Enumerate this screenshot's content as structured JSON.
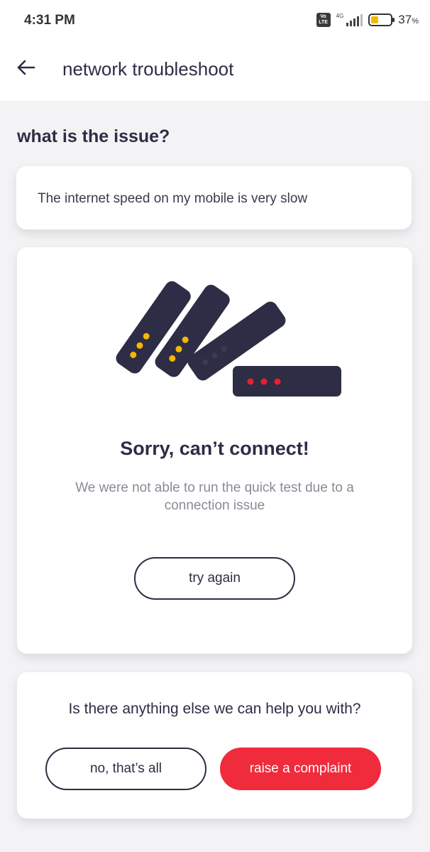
{
  "status_bar": {
    "time": "4:31 PM",
    "volte_label": "Vo LTE",
    "network_type": "4G",
    "battery_percent": "37",
    "battery_percent_sign": "%",
    "battery_level": 0.37,
    "battery_color": "#f5b800"
  },
  "header": {
    "back_icon": "arrow-left-icon",
    "title": "network troubleshoot"
  },
  "issue_section": {
    "title": "what is the issue?",
    "issue_text": "The internet speed on my mobile is very slow"
  },
  "error_card": {
    "illustration": "fallen-routers-illustration",
    "title": "Sorry, can’t connect!",
    "description": "We were not able to run the quick test due to a connection issue",
    "try_again_label": "try again"
  },
  "help_card": {
    "question": "Is there anything else we can help you with?",
    "no_label": "no, that’s all",
    "complaint_label": "raise a complaint"
  },
  "colors": {
    "text_dark": "#2d2d45",
    "accent_red": "#ef2b3c",
    "led_yellow": "#f5b800",
    "led_red": "#e8202e",
    "device_navy": "#2d2d45"
  }
}
